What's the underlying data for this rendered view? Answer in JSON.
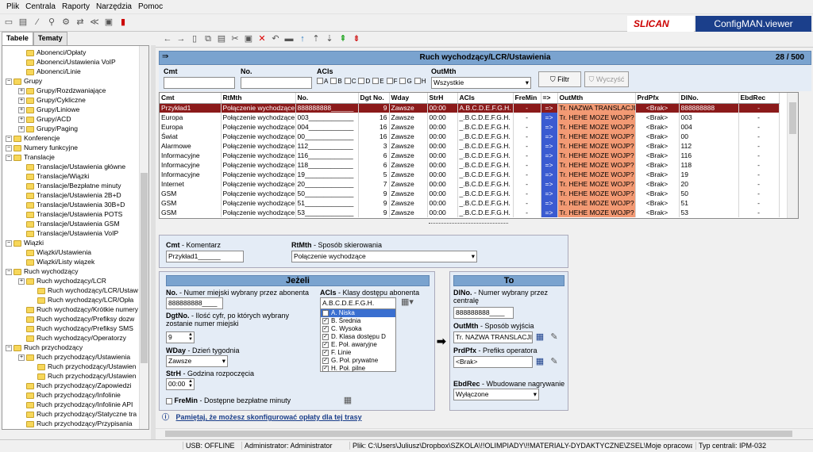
{
  "menu": [
    "Plik",
    "Centrala",
    "Raporty",
    "Narzędzia",
    "Pomoc"
  ],
  "logo": "SLICAN",
  "app_title": "ConfigMAN.viewer",
  "left_tabs": [
    "Tabele",
    "Tematy"
  ],
  "tree": [
    {
      "label": "Abonenci/Opłaty",
      "lvl": 2
    },
    {
      "label": "Abonenci/Ustawienia VoIP",
      "lvl": 2
    },
    {
      "label": "Abonenci/Linie",
      "lvl": 2
    },
    {
      "label": "Grupy",
      "lvl": 0
    },
    {
      "label": "Grupy/Rozdzwaniające",
      "lvl": 1
    },
    {
      "label": "Grupy/Cykliczne",
      "lvl": 1
    },
    {
      "label": "Grupy/Liniowe",
      "lvl": 1
    },
    {
      "label": "Grupy/ACD",
      "lvl": 1
    },
    {
      "label": "Grupy/Paging",
      "lvl": 1
    },
    {
      "label": "Konferencje",
      "lvl": 0
    },
    {
      "label": "Numery funkcyjne",
      "lvl": 0
    },
    {
      "label": "Translacje",
      "lvl": 0
    },
    {
      "label": "Translacje/Ustawienia główne",
      "lvl": 2
    },
    {
      "label": "Translacje/Wiązki",
      "lvl": 2
    },
    {
      "label": "Translacje/Bezpłatne minuty",
      "lvl": 2
    },
    {
      "label": "Translacje/Ustawienia 2B+D",
      "lvl": 2
    },
    {
      "label": "Translacje/Ustawienia 30B+D",
      "lvl": 2
    },
    {
      "label": "Translacje/Ustawienia POTS",
      "lvl": 2
    },
    {
      "label": "Translacje/Ustawienia GSM",
      "lvl": 2
    },
    {
      "label": "Translacje/Ustawienia VoIP",
      "lvl": 2
    },
    {
      "label": "Wiązki",
      "lvl": 0
    },
    {
      "label": "Wiązki/Ustawienia",
      "lvl": 2
    },
    {
      "label": "Wiązki/Listy wiązek",
      "lvl": 2
    },
    {
      "label": "Ruch wychodzący",
      "lvl": 0
    },
    {
      "label": "Ruch wychodzący/LCR",
      "lvl": 1
    },
    {
      "label": "Ruch wychodzący/LCR/Ustaw",
      "lvl": 3
    },
    {
      "label": "Ruch wychodzący/LCR/Opła",
      "lvl": 3
    },
    {
      "label": "Ruch wychodzący/Krótkie numery",
      "lvl": 2
    },
    {
      "label": "Ruch wychodzący/Prefiksy dozw",
      "lvl": 2
    },
    {
      "label": "Ruch wychodzący/Prefiksy SMS",
      "lvl": 2
    },
    {
      "label": "Ruch wychodzący/Operatorzy",
      "lvl": 2
    },
    {
      "label": "Ruch przychodzący",
      "lvl": 0
    },
    {
      "label": "Ruch przychodzący/Ustawienia",
      "lvl": 1
    },
    {
      "label": "Ruch przychodzący/Ustawien",
      "lvl": 3
    },
    {
      "label": "Ruch przychodzący/Ustawien",
      "lvl": 3
    },
    {
      "label": "Ruch przychodzący/Zapowiedzi",
      "lvl": 2
    },
    {
      "label": "Ruch przychodzący/Infolinie",
      "lvl": 2
    },
    {
      "label": "Ruch przychodzący/Infolinie API",
      "lvl": 2
    },
    {
      "label": "Ruch przychodzący/Statyczne tra",
      "lvl": 2
    },
    {
      "label": "Ruch przychodzący/Przypisania",
      "lvl": 2
    }
  ],
  "table_title": "Ruch wychodzący/LCR/Ustawienia",
  "table_count": "28 / 500",
  "filter": {
    "cmt_label": "Cmt",
    "no_label": "No.",
    "acls_label": "ACls",
    "outmth_label": "OutMth",
    "acls_letters": [
      "A",
      "B",
      "C",
      "D",
      "E",
      "F",
      "G",
      "H"
    ],
    "outmth_value": "Wszystkie",
    "filtr_btn": "Filtr",
    "wyczysc_btn": "Wyczyść"
  },
  "columns": [
    "Cmt",
    "RtMth",
    "No.",
    "Dgt No.",
    "Wday",
    "StrH",
    "ACls",
    "FreMin",
    "=>",
    "OutMth",
    "PrdPfx",
    "DlNo.",
    "EbdRec"
  ],
  "rows": [
    [
      "Przykład1",
      "Połączenie wychodzące",
      "888888888______",
      "9",
      "Zawsze",
      "00:00",
      "A.B.C.D.E.F.G.H.",
      "-",
      "=>",
      "Tr. NAZWA TRANSLACJI",
      "<Brak>",
      "888888888",
      "-"
    ],
    [
      "Europa",
      "Połączenie wychodzące",
      "003____________",
      "16",
      "Zawsze",
      "00:00",
      "_.B.C.D.E.F.G.H.",
      "-",
      "=>",
      "Tr. HEHE MOZE WOJP?",
      "<Brak>",
      "003",
      "-"
    ],
    [
      "Europa",
      "Połączenie wychodzące",
      "004____________",
      "16",
      "Zawsze",
      "00:00",
      "_.B.C.D.E.F.G.H.",
      "-",
      "=>",
      "Tr. HEHE MOZE WOJP?",
      "<Brak>",
      "004",
      "-"
    ],
    [
      "Świat",
      "Połączenie wychodzące",
      "00_____________",
      "16",
      "Zawsze",
      "00:00",
      "_.B.C.D.E.F.G.H.",
      "-",
      "=>",
      "Tr. HEHE MOZE WOJP?",
      "<Brak>",
      "00",
      "-"
    ],
    [
      "Alarmowe",
      "Połączenie wychodzące",
      "112____________",
      "3",
      "Zawsze",
      "00:00",
      "_.B.C.D.E.F.G.H.",
      "-",
      "=>",
      "Tr. HEHE MOZE WOJP?",
      "<Brak>",
      "112",
      "-"
    ],
    [
      "Informacyjne",
      "Połączenie wychodzące",
      "116____________",
      "6",
      "Zawsze",
      "00:00",
      "_.B.C.D.E.F.G.H.",
      "-",
      "=>",
      "Tr. HEHE MOZE WOJP?",
      "<Brak>",
      "116",
      "-"
    ],
    [
      "Informacyjne",
      "Połączenie wychodzące",
      "118____________",
      "6",
      "Zawsze",
      "00:00",
      "_.B.C.D.E.F.G.H.",
      "-",
      "=>",
      "Tr. HEHE MOZE WOJP?",
      "<Brak>",
      "118",
      "-"
    ],
    [
      "Informacyjne",
      "Połączenie wychodzące",
      "19_____________",
      "5",
      "Zawsze",
      "00:00",
      "_.B.C.D.E.F.G.H.",
      "-",
      "=>",
      "Tr. HEHE MOZE WOJP?",
      "<Brak>",
      "19",
      "-"
    ],
    [
      "Internet",
      "Połączenie wychodzące",
      "20_____________",
      "7",
      "Zawsze",
      "00:00",
      "_.B.C.D.E.F.G.H.",
      "-",
      "=>",
      "Tr. HEHE MOZE WOJP?",
      "<Brak>",
      "20",
      "-"
    ],
    [
      "GSM",
      "Połączenie wychodzące",
      "50_____________",
      "9",
      "Zawsze",
      "00:00",
      "_.B.C.D.E.F.G.H.",
      "-",
      "=>",
      "Tr. HEHE MOZE WOJP?",
      "<Brak>",
      "50",
      "-"
    ],
    [
      "GSM",
      "Połączenie wychodzące",
      "51_____________",
      "9",
      "Zawsze",
      "00:00",
      "_.B.C.D.E.F.G.H.",
      "-",
      "=>",
      "Tr. HEHE MOZE WOJP?",
      "<Brak>",
      "51",
      "-"
    ],
    [
      "GSM",
      "Połączenie wychodzące",
      "53_____________",
      "9",
      "Zawsze",
      "00:00",
      "_.B.C.D.E.F.G.H.",
      "-",
      "=>",
      "Tr. HEHE MOZE WOJP?",
      "<Brak>",
      "53",
      "-"
    ]
  ],
  "detail": {
    "cmt_label": "Cmt",
    "cmt_desc": " - Komentarz",
    "cmt_value": "Przykład1______",
    "rtmth_label": "RtMth",
    "rtmth_desc": " - Sposób skierowania",
    "rtmth_value": "Połączenie wychodzące",
    "jezeli": "Jeżeli",
    "no_label": "No.",
    "no_desc": " - Numer miejski wybrany przez abonenta",
    "no_value": "888888888____",
    "dgtno_label": "DgtNo.",
    "dgtno_desc": " - Ilość cyfr, po których wybrany zostanie numer miejski",
    "dgtno_value": "9",
    "wday_label": "WDay",
    "wday_desc": " - Dzień tygodnia",
    "wday_value": "Zawsze",
    "strh_label": "StrH",
    "strh_desc": " - Godzina rozpoczęcia",
    "strh_value": "00:00",
    "fremin_label": "FreMin",
    "fremin_desc": " - Dostępne bezpłatne minuty",
    "acls_label": "ACls",
    "acls_desc": " - Klasy dostępu abonenta",
    "acls_value": "A.B.C.D.E.F.G.H.",
    "acls_list": [
      "A. Niska",
      "B. Średnia",
      "C. Wysoka",
      "D. Klasa dostępu D",
      "E. Poł. awaryjne",
      "F. Linie",
      "G. Poł. prywatne",
      "H. Poł. pilne"
    ],
    "to": "To",
    "dlno_label": "DlNo.",
    "dlno_desc": " - Numer wybrany przez centralę",
    "dlno_value": "888888888____",
    "outmth_label": "OutMth",
    "outmth_desc": " - Sposób wyjścia",
    "outmth_value": "Tr. NAZWA TRANSLACJI",
    "prdpfx_label": "PrdPfx",
    "prdpfx_desc": " - Prefiks operatora",
    "prdpfx_value": "<Brak>",
    "ebdrec_label": "EbdRec",
    "ebdrec_desc": " - Wbudowane nagrywanie",
    "ebdrec_value": "Wyłączone",
    "note": "Pamiętaj, że możesz skonfigurować opłaty dla tej trasy"
  },
  "status": {
    "usb": "USB: OFFLINE",
    "admin": "Administrator: Administrator",
    "file": "Plik: C:\\Users\\Juliusz\\Dropbox\\SZKOLA\\!!OLIMPIADY\\!!MATERIALY-DYDAKTYCZNE\\ZSEL\\Moje opracowani",
    "type": "Typ centrali: IPM-032"
  },
  "colors": {
    "accent": "#7aa3cf",
    "selected_row": "#8b1a1a",
    "arrow_cell": "#3a5bd1",
    "outmth_cell": "#f39a74",
    "brand": "#1b3f8b"
  }
}
